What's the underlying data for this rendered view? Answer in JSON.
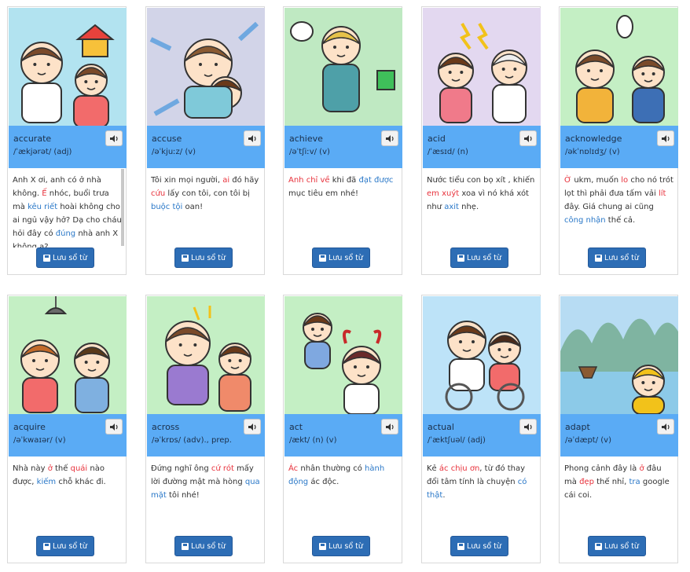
{
  "save_label": "Lưu sổ từ",
  "cards": [
    {
      "word": "accurate",
      "ipa": "/ˈækjərət/ (adj)",
      "bg": "#b2e3f0",
      "desc": [
        {
          "t": "Anh X ơi, anh có ở nhà không. "
        },
        {
          "t": "Ế",
          "c": "r"
        },
        {
          "t": " nhóc, buổi trưa mà "
        },
        {
          "t": "kêu riết",
          "c": "b"
        },
        {
          "t": " hoài không cho ai ngủ vậy hở? Dạ cho cháu hỏi đây có "
        },
        {
          "t": "đúng",
          "c": "b"
        },
        {
          "t": " nhà anh X không ạ?"
        }
      ]
    },
    {
      "word": "accuse",
      "ipa": "/əˈkjuːz/ (v)",
      "bg": "#d2d4e8",
      "desc": [
        {
          "t": "Tôi xin mọi người, "
        },
        {
          "t": "ai",
          "c": "r"
        },
        {
          "t": " đó hãy "
        },
        {
          "t": "cứu",
          "c": "r"
        },
        {
          "t": " lấy con tôi, con tôi bị "
        },
        {
          "t": "buộc tội",
          "c": "b"
        },
        {
          "t": " oan!"
        }
      ]
    },
    {
      "word": "achieve",
      "ipa": "/əˈtʃiːv/ (v)",
      "bg": "#bfe9c2",
      "desc": [
        {
          "t": "Anh chỉ về",
          "c": "r"
        },
        {
          "t": " khi đã "
        },
        {
          "t": "đạt được",
          "c": "b"
        },
        {
          "t": " mục tiêu em nhé!"
        }
      ]
    },
    {
      "word": "acid",
      "ipa": "/ˈæsɪd/ (n)",
      "bg": "#e3d8f0",
      "desc": [
        {
          "t": "Nước tiểu con bọ xít , khiến "
        },
        {
          "t": "em xuýt",
          "c": "r"
        },
        {
          "t": " xoa vì nó khá xót như "
        },
        {
          "t": "axit",
          "c": "b"
        },
        {
          "t": " nhẹ."
        }
      ]
    },
    {
      "word": "acknowledge",
      "ipa": "/əkˈnɒlɪdʒ/ (v)",
      "bg": "#c4efc4",
      "desc": [
        {
          "t": "Ờ",
          "c": "r"
        },
        {
          "t": " ukm, muốn "
        },
        {
          "t": "lo",
          "c": "r"
        },
        {
          "t": " cho nó trót lọt thì phải đưa tấm vải "
        },
        {
          "t": "lít",
          "c": "r"
        },
        {
          "t": " đây. Giá chung ai cũng "
        },
        {
          "t": "công nhận",
          "c": "b"
        },
        {
          "t": " thế cả."
        }
      ]
    },
    {
      "word": "acquire",
      "ipa": "/əˈkwaɪər/ (v)",
      "bg": "#c4efc4",
      "desc": [
        {
          "t": "Nhà này "
        },
        {
          "t": "ở",
          "c": "r"
        },
        {
          "t": " thế "
        },
        {
          "t": "quái",
          "c": "r"
        },
        {
          "t": " nào được, "
        },
        {
          "t": "kiếm",
          "c": "b"
        },
        {
          "t": " chỗ khác đi."
        }
      ]
    },
    {
      "word": "across",
      "ipa": "/əˈkrɒs/ (adv)., prep.",
      "bg": "#c4efc4",
      "desc": [
        {
          "t": "Đứng nghĩ ông "
        },
        {
          "t": "cứ rót",
          "c": "r"
        },
        {
          "t": " mấy lời đường mật mà hòng "
        },
        {
          "t": "qua mặt",
          "c": "b"
        },
        {
          "t": " tôi nhé!"
        }
      ]
    },
    {
      "word": "act",
      "ipa": "/ækt/ (n) (v)",
      "bg": "#c4efc4",
      "desc": [
        {
          "t": "Ác",
          "c": "r"
        },
        {
          "t": " nhân thường có "
        },
        {
          "t": "hành động",
          "c": "b"
        },
        {
          "t": " ác độc."
        }
      ]
    },
    {
      "word": "actual",
      "ipa": "/ˈæktʃuəl/ (adj)",
      "bg": "#bde3f8",
      "desc": [
        {
          "t": "Kẻ "
        },
        {
          "t": "ác chịu ơn",
          "c": "r"
        },
        {
          "t": ", từ đó thay đổi tâm tính là chuyện "
        },
        {
          "t": "có thật",
          "c": "b"
        },
        {
          "t": "."
        }
      ]
    },
    {
      "word": "adapt",
      "ipa": "/əˈdæpt/ (v)",
      "bg": "#b7dcf3",
      "desc": [
        {
          "t": "Phong cảnh đây là "
        },
        {
          "t": "ở",
          "c": "r"
        },
        {
          "t": " đâu mà "
        },
        {
          "t": "đẹp",
          "c": "r"
        },
        {
          "t": " thế nhỉ, "
        },
        {
          "t": "tra",
          "c": "b"
        },
        {
          "t": " google cái coi."
        }
      ]
    }
  ]
}
